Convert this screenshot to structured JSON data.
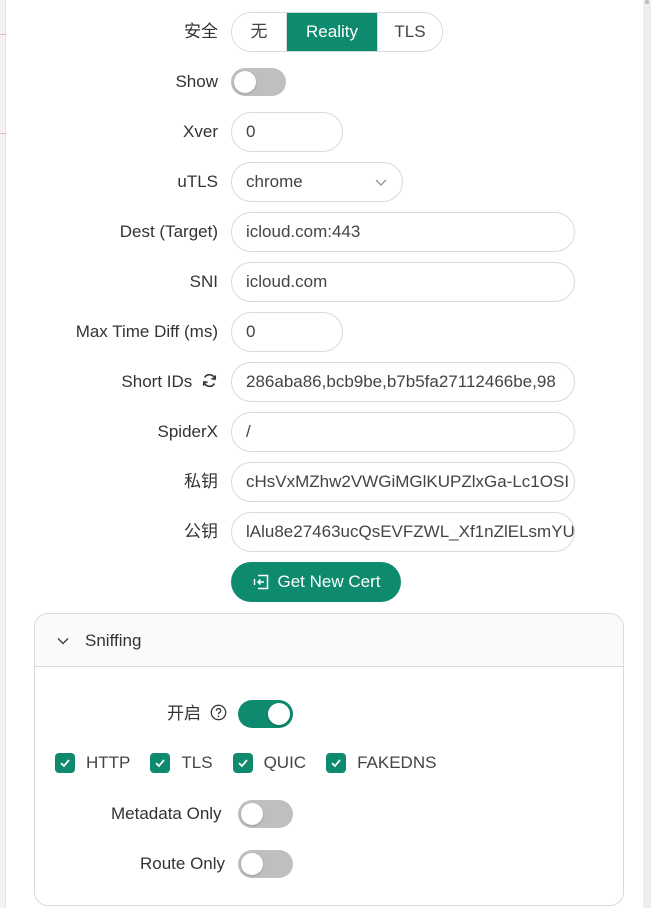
{
  "security": {
    "label": "安全",
    "options": [
      "无",
      "Reality",
      "TLS"
    ],
    "selected": "Reality"
  },
  "show": {
    "label": "Show",
    "on": false
  },
  "xver": {
    "label": "Xver",
    "value": "0"
  },
  "utls": {
    "label": "uTLS",
    "value": "chrome"
  },
  "dest": {
    "label": "Dest (Target)",
    "value": "icloud.com:443"
  },
  "sni": {
    "label": "SNI",
    "value": "icloud.com"
  },
  "max_time_diff": {
    "label": "Max Time Diff (ms)",
    "value": "0"
  },
  "short_ids": {
    "label": "Short IDs",
    "value": "286aba86,bcb9be,b7b5fa27112466be,98"
  },
  "spider_x": {
    "label": "SpiderX",
    "value": "/"
  },
  "private_key": {
    "label": "私钥",
    "value": "cHsVxMZhw2VWGiMGlKUPZlxGa-Lc1OSI"
  },
  "public_key": {
    "label": "公钥",
    "value": "lAlu8e27463ucQsEVFZWL_Xf1nZlELsmYU"
  },
  "get_cert_button": "Get New Cert",
  "sniffing": {
    "title": "Sniffing",
    "enable_label": "开启",
    "enabled": true,
    "protocols": [
      {
        "label": "HTTP",
        "checked": true
      },
      {
        "label": "TLS",
        "checked": true
      },
      {
        "label": "QUIC",
        "checked": true
      },
      {
        "label": "FAKEDNS",
        "checked": true
      }
    ],
    "metadata_only": {
      "label": "Metadata Only",
      "on": false
    },
    "route_only": {
      "label": "Route Only",
      "on": false
    }
  },
  "colors": {
    "accent": "#0e8a6e",
    "switch_off": "#bfbfbf",
    "border": "#d9d9d9"
  }
}
